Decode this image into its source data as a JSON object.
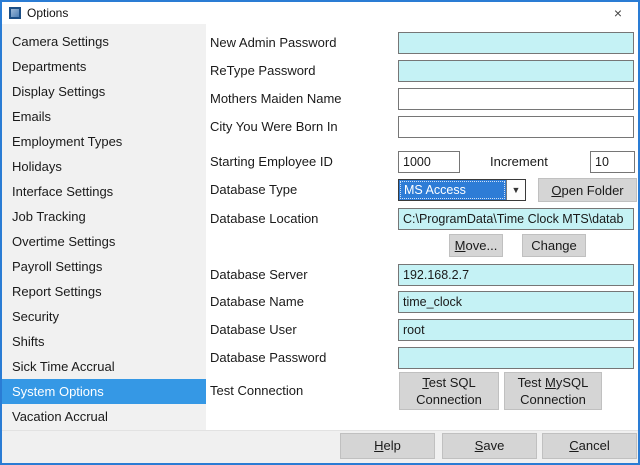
{
  "window": {
    "title": "Options",
    "close_glyph": "×"
  },
  "sidebar": {
    "items": [
      "Camera Settings",
      "Departments",
      "Display Settings",
      "Emails",
      "Employment Types",
      "Holidays",
      "Interface Settings",
      "Job Tracking",
      "Overtime Settings",
      "Payroll Settings",
      "Report Settings",
      "Security",
      "Shifts",
      "Sick Time Accrual",
      "System Options",
      "Vacation Accrual"
    ],
    "selected": "System Options"
  },
  "form": {
    "new_admin_password": {
      "label": "New Admin Password",
      "value": ""
    },
    "retype_password": {
      "label": "ReType Password",
      "value": ""
    },
    "mothers_maiden_name": {
      "label": "Mothers Maiden Name",
      "value": ""
    },
    "city_born": {
      "label": "City You Were Born In",
      "value": ""
    },
    "starting_employee_id": {
      "label": "Starting Employee ID",
      "value": "1000"
    },
    "increment": {
      "label": "Increment",
      "value": "10"
    },
    "database_type": {
      "label": "Database Type",
      "value": "MS Access"
    },
    "open_folder_button": {
      "key": "O",
      "rest": "pen Folder"
    },
    "database_location": {
      "label": "Database Location",
      "value": "C:\\ProgramData\\Time Clock MTS\\datab"
    },
    "move_button": {
      "key": "M",
      "rest": "ove..."
    },
    "change_button": {
      "label": "Change"
    },
    "database_server": {
      "label": "Database Server",
      "value": "192.168.2.7"
    },
    "database_name": {
      "label": "Database Name",
      "value": "time_clock"
    },
    "database_user": {
      "label": "Database User",
      "value": "root"
    },
    "database_password": {
      "label": "Database Password",
      "value": ""
    },
    "test_connection_label": "Test Connection",
    "test_sql_button": {
      "key": "T",
      "rest": "est SQL",
      "line2": "Connection"
    },
    "test_mysql_button": {
      "pre": "Test ",
      "key": "M",
      "rest": "ySQL",
      "line2": "Connection"
    }
  },
  "footer": {
    "help_button": {
      "key": "H",
      "rest": "elp"
    },
    "save_button": {
      "key": "S",
      "rest": "ave"
    },
    "cancel_button": {
      "key": "C",
      "rest": "ancel"
    }
  },
  "colors": {
    "window_border": "#2a7cd4",
    "sidebar_selection": "#3598e5",
    "combo_selection": "#2e7cd6",
    "field_cyan": "#c5f2f5",
    "button_gray": "#d5d5d5"
  }
}
